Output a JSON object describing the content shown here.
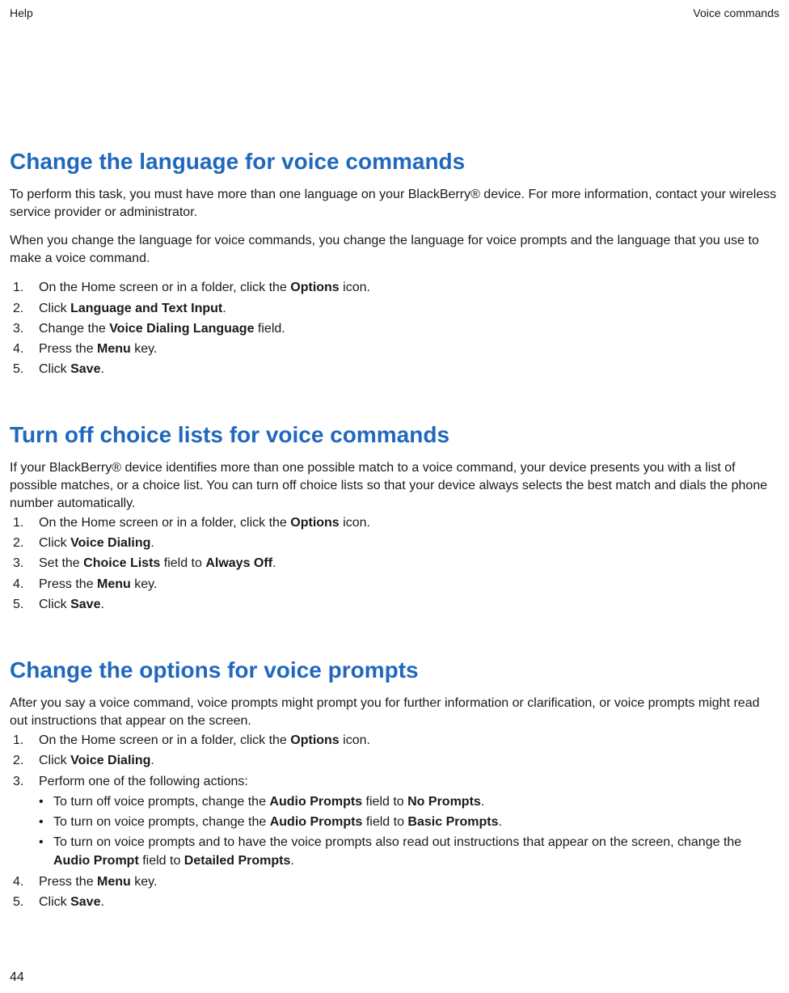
{
  "header": {
    "left": "Help",
    "right": "Voice commands"
  },
  "page_number": "44",
  "sections": [
    {
      "title": "Change the language for voice commands",
      "intro": [
        "To perform this task, you must have more than one language on your BlackBerry® device. For more information, contact your wireless service provider or administrator.",
        "When you change the language for voice commands, you change the language for voice prompts and the language that you use to make a voice command."
      ],
      "steps": [
        {
          "pre": "On the Home screen or in a folder, click the ",
          "b": "Options",
          "post": " icon."
        },
        {
          "pre": "Click ",
          "b": "Language and Text Input",
          "post": "."
        },
        {
          "pre": "Change the ",
          "b": "Voice Dialing Language",
          "post": " field."
        },
        {
          "pre": "Press the ",
          "b": "Menu",
          "post": " key."
        },
        {
          "pre": "Click ",
          "b": "Save",
          "post": "."
        }
      ]
    },
    {
      "title": "Turn off choice lists for voice commands",
      "intro": [
        "If your BlackBerry® device identifies more than one possible match to a voice command, your device presents you with a list of possible matches, or a choice list. You can turn off choice lists so that your device always selects the best match and dials the phone number automatically."
      ],
      "steps": [
        {
          "pre": "On the Home screen or in a folder, click the ",
          "b": "Options",
          "post": " icon."
        },
        {
          "pre": "Click ",
          "b": "Voice Dialing",
          "post": "."
        },
        {
          "pre": "Set the ",
          "b": "Choice Lists",
          "mid": " field to ",
          "b2": "Always Off",
          "post": "."
        },
        {
          "pre": "Press the ",
          "b": "Menu",
          "post": " key."
        },
        {
          "pre": "Click ",
          "b": "Save",
          "post": "."
        }
      ]
    },
    {
      "title": "Change the options for voice prompts",
      "intro": [
        "After you say a voice command, voice prompts might prompt you for further information or clarification, or voice prompts might read out instructions that appear on the screen."
      ],
      "steps": [
        {
          "pre": "On the Home screen or in a folder, click the ",
          "b": "Options",
          "post": " icon."
        },
        {
          "pre": "Click ",
          "b": "Voice Dialing",
          "post": "."
        },
        {
          "pre": "Perform one of the following actions:",
          "sublist": [
            {
              "pre": "To turn off voice prompts, change the ",
              "b": "Audio Prompts",
              "mid": " field to ",
              "b2": "No Prompts",
              "post": "."
            },
            {
              "pre": "To turn on voice prompts, change the ",
              "b": "Audio Prompts",
              "mid": " field to ",
              "b2": "Basic Prompts",
              "post": "."
            },
            {
              "pre": "To turn on voice prompts and to have the voice prompts also read out instructions that appear on the screen, change the ",
              "b": "Audio Prompt",
              "mid": " field to ",
              "b2": "Detailed Prompts",
              "post": "."
            }
          ]
        },
        {
          "pre": "Press the ",
          "b": "Menu",
          "post": " key."
        },
        {
          "pre": "Click ",
          "b": "Save",
          "post": "."
        }
      ]
    }
  ]
}
